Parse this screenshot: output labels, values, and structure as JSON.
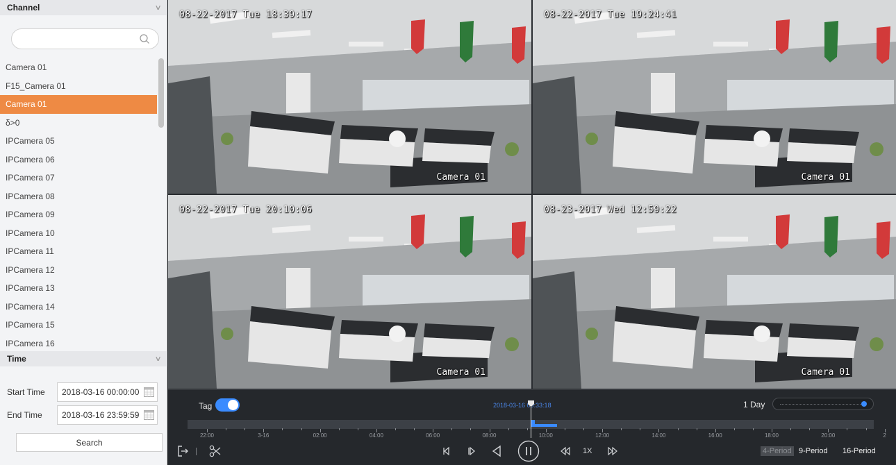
{
  "sidebar": {
    "channel_header": "Channel",
    "search_placeholder": "",
    "channels": [
      "Camera 01",
      "F15_Camera 01",
      "Camera 01",
      "δ>0",
      "IPCamera 05",
      "IPCamera 06",
      "IPCamera 07",
      "IPCamera 08",
      "IPCamera 09",
      "IPCamera 10",
      "IPCamera 11",
      "IPCamera 12",
      "IPCamera 13",
      "IPCamera 14",
      "IPCamera 15",
      "IPCamera 16"
    ],
    "selected_index": 2,
    "time_header": "Time",
    "start_label": "Start Time",
    "start_value": "2018-03-16 00:00:00",
    "end_label": "End Time",
    "end_value": "2018-03-16 23:59:59",
    "search_button": "Search"
  },
  "tiles": [
    {
      "timestamp": "08-22-2017 Tue 18:39:17",
      "camera": "Camera 01"
    },
    {
      "timestamp": "08-22-2017 Tue 19:24:41",
      "camera": "Camera 01"
    },
    {
      "timestamp": "08-22-2017 Tue 20:10:06",
      "camera": "Camera 01"
    },
    {
      "timestamp": "08-23-2017 Wed 12:59:22",
      "camera": "Camera 01"
    }
  ],
  "timeline": {
    "tag_label": "Tag",
    "tag_enabled": true,
    "cursor_time": "2018-03-16 09:33:18",
    "zoom_label": "1 Day",
    "tick_labels": [
      "22:00",
      "3-16",
      "02:00",
      "04:00",
      "06:00",
      "08:00",
      "10:00",
      "12:00",
      "14:00",
      "16:00",
      "18:00",
      "20:00",
      "2"
    ]
  },
  "toolbar": {
    "speed": "1X",
    "period_4": "4-Period",
    "period_9": "9-Period",
    "period_16": "16-Period"
  },
  "colors": {
    "accent": "#ee8a44",
    "timeline_blue": "#3a8bff"
  }
}
